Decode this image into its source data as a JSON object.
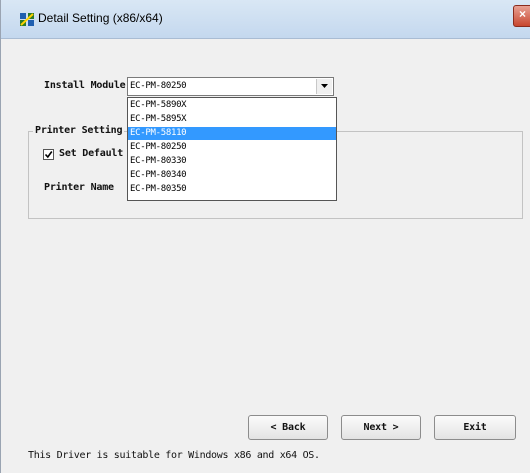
{
  "window": {
    "title": "Detail Setting (x86/x64)",
    "close_label": "×"
  },
  "install_module": {
    "label": "Install Module",
    "selected_value": "EC-PM-80250",
    "options": [
      "EC-PM-5890X",
      "EC-PM-5895X",
      "EC-PM-58110",
      "EC-PM-80250",
      "EC-PM-80330",
      "EC-PM-80340",
      "EC-PM-80350"
    ],
    "highlighted_index": 2
  },
  "printer_setting": {
    "group_label": "Printer Setting",
    "set_default_label": "Set Default",
    "set_default_checked": true,
    "printer_name_label": "Printer Name"
  },
  "buttons": {
    "back": "< Back",
    "next": "Next >",
    "exit": "Exit"
  },
  "footer": {
    "text": "This Driver is suitable for Windows x86 and x64 OS."
  },
  "colors": {
    "highlight": "#3399ff",
    "titlebar": "#c4d8ee",
    "close_button": "#c8472f"
  }
}
